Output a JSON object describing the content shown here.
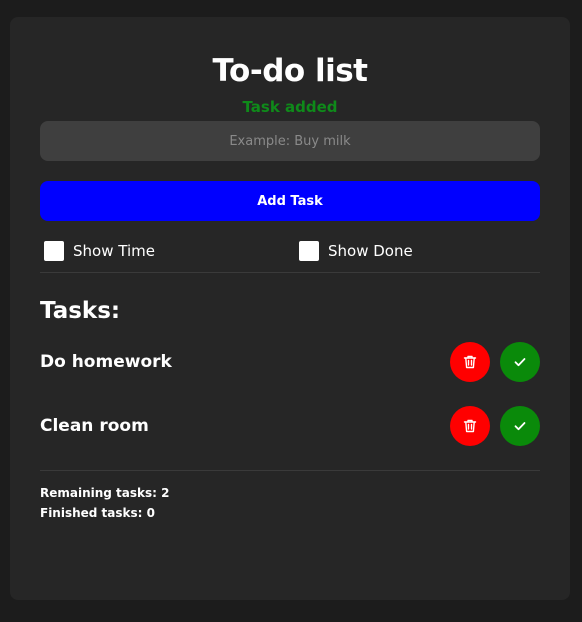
{
  "app": {
    "title": "To-do list",
    "status_message": "Task added"
  },
  "input": {
    "placeholder": "Example: Buy milk",
    "value": ""
  },
  "add_button_label": "Add Task",
  "options": {
    "show_time": {
      "label": "Show Time",
      "checked": false
    },
    "show_done": {
      "label": "Show Done",
      "checked": false
    }
  },
  "tasks_heading": "Tasks:",
  "tasks": [
    {
      "name": "Do homework"
    },
    {
      "name": "Clean room"
    }
  ],
  "icons": {
    "delete": "trash-icon",
    "done": "check-icon"
  },
  "stats": {
    "remaining": "Remaining tasks: 2",
    "finished": "Finished tasks: 0"
  },
  "colors": {
    "status_green": "#0f8a1a",
    "add_button": "#0000ff",
    "delete_button": "#ff0000",
    "done_button": "#0a8a0a"
  }
}
